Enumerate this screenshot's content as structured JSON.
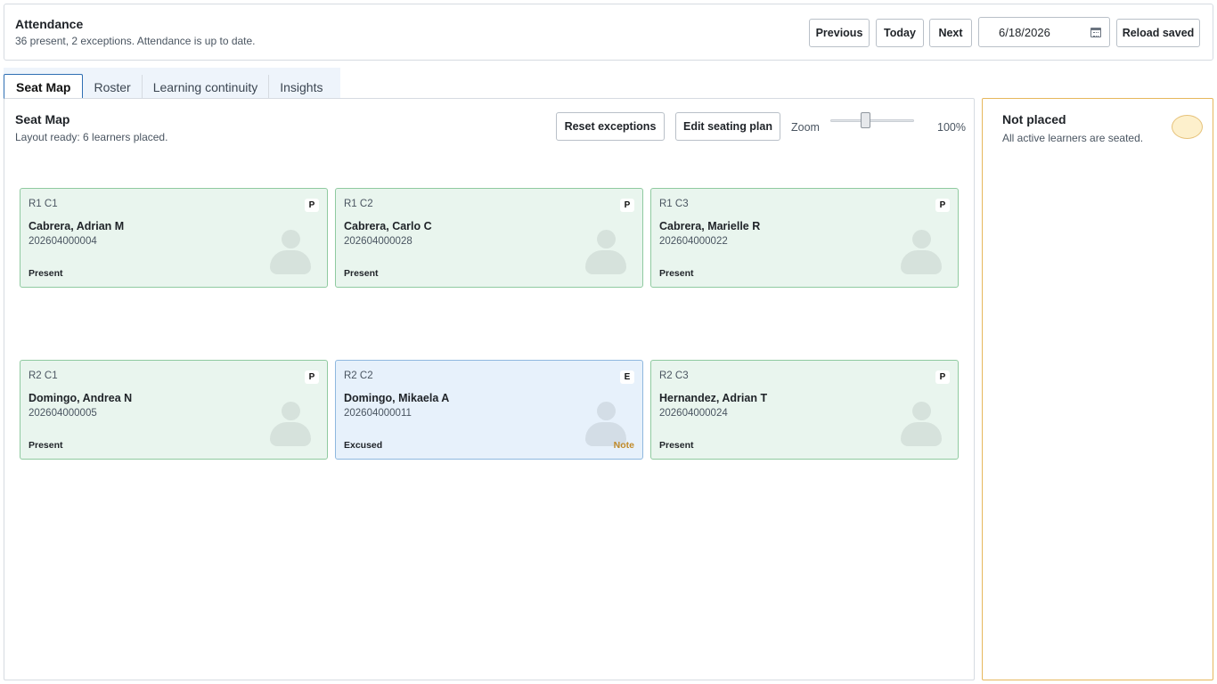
{
  "header": {
    "title": "Attendance",
    "subtitle": "36 present, 2 exceptions. Attendance is up to date.",
    "buttons": {
      "previous": "Previous",
      "today": "Today",
      "next": "Next",
      "reload": "Reload saved"
    },
    "date_value": "6/18/2026",
    "calendar_icon": "calendar-icon"
  },
  "tabs": [
    {
      "label": "Seat Map",
      "active": true
    },
    {
      "label": "Roster",
      "active": false
    },
    {
      "label": "Learning continuity",
      "active": false
    },
    {
      "label": "Insights",
      "active": false
    }
  ],
  "seatmap": {
    "title": "Seat Map",
    "subtitle": "Layout ready: 6 learners placed.",
    "reset_label": "Reset exceptions",
    "edit_label": "Edit seating plan",
    "zoom_label": "Zoom",
    "zoom_value": "100%",
    "zoom_level": 0.4
  },
  "seats": [
    {
      "pos": "R1 C1",
      "badge": "P",
      "name": "Cabrera, Adrian M",
      "id": "202604000004",
      "status": "Present",
      "note": ""
    },
    {
      "pos": "R1 C2",
      "badge": "P",
      "name": "Cabrera, Carlo C",
      "id": "202604000028",
      "status": "Present",
      "note": ""
    },
    {
      "pos": "R1 C3",
      "badge": "P",
      "name": "Cabrera, Marielle R",
      "id": "202604000022",
      "status": "Present",
      "note": ""
    },
    {
      "pos": "R2 C1",
      "badge": "P",
      "name": "Domingo, Andrea N",
      "id": "202604000005",
      "status": "Present",
      "note": ""
    },
    {
      "pos": "R2 C2",
      "badge": "E",
      "name": "Domingo, Mikaela A",
      "id": "202604000011",
      "status": "Excused",
      "note": "Note"
    },
    {
      "pos": "R2 C3",
      "badge": "P",
      "name": "Hernandez, Adrian T",
      "id": "202604000024",
      "status": "Present",
      "note": ""
    }
  ],
  "side": {
    "title": "Not placed",
    "subtitle": "All active learners are seated."
  },
  "colors": {
    "present_bg": "#e9f5ee",
    "present_border": "#8fcaa0",
    "excused_bg": "#e7f1fb",
    "excused_border": "#8fb8df",
    "note": "#c08a2a",
    "side_border": "#e6b75c",
    "tab_active_border": "#2f6fb3"
  }
}
